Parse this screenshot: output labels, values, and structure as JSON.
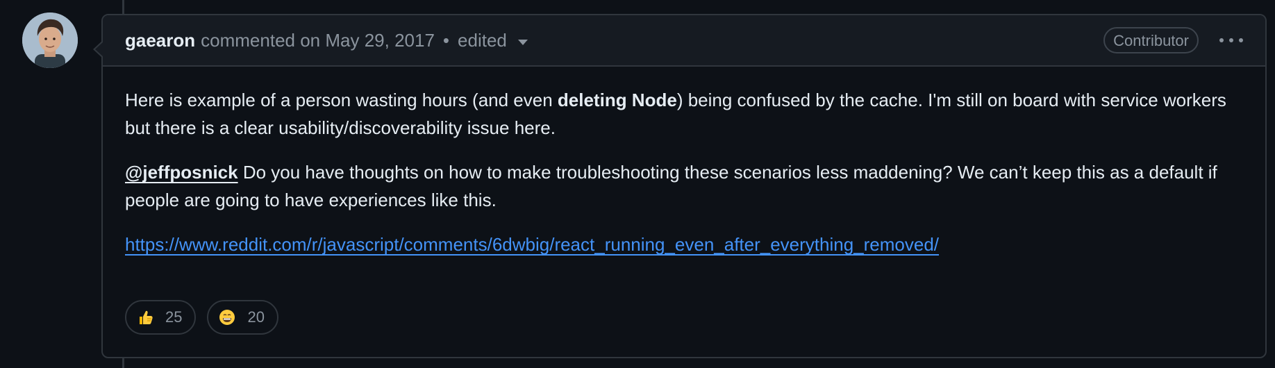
{
  "comment": {
    "author": "gaearon",
    "action_text": "commented on May 29, 2017",
    "separator": "•",
    "edited_label": "edited",
    "role_badge": "Contributor",
    "avatar_icon": "user-avatar-icon",
    "body": {
      "p1_before": "Here is example of a person wasting hours (and even ",
      "p1_bold": "deleting Node",
      "p1_after": ") being confused by the cache. I'm still on board with service workers but there is a clear usability/discoverability issue here.",
      "p2_mention": "@jeffposnick",
      "p2_after": " Do you have thoughts on how to make troubleshooting these scenarios less maddening? We can’t keep this as a default if people are going to have experiences like this.",
      "link_text": "https://www.reddit.com/r/javascript/comments/6dwbig/react_running_even_after_everything_removed/"
    },
    "reactions": [
      {
        "icon": "thumbs-up-icon",
        "count": "25"
      },
      {
        "icon": "grinning-face-icon",
        "count": "20"
      }
    ]
  },
  "colors": {
    "background": "#0d1117",
    "header_background": "#161b22",
    "border": "#30363d",
    "text": "#e6edf3",
    "muted_text": "#8b949e",
    "link": "#4493f8"
  }
}
